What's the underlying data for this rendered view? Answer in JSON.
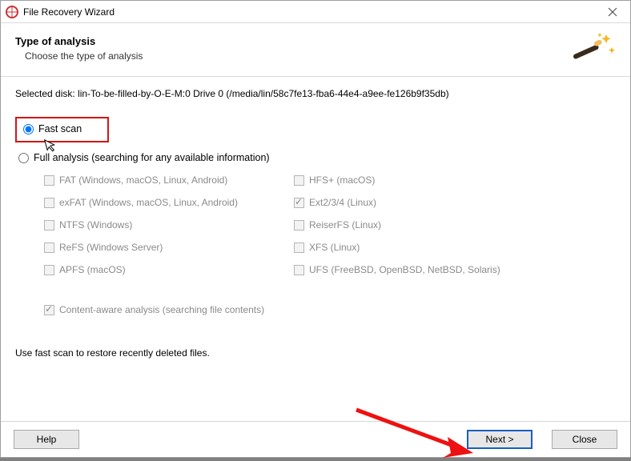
{
  "titlebar": {
    "title": "File Recovery Wizard"
  },
  "header": {
    "title": "Type of analysis",
    "subtitle": "Choose the type of analysis"
  },
  "body": {
    "selected_disk": "Selected disk: lin-To-be-filled-by-O-E-M:0 Drive 0 (/media/lin/58c7fe13-fba6-44e4-a9ee-fe126b9f35db)",
    "radio_fast": "Fast scan",
    "radio_full": "Full analysis (searching for any available information)",
    "fs_left": [
      "FAT (Windows, macOS, Linux, Android)",
      "exFAT (Windows, macOS, Linux, Android)",
      "NTFS (Windows)",
      "ReFS (Windows Server)",
      "APFS (macOS)"
    ],
    "fs_right": [
      "HFS+ (macOS)",
      "Ext2/3/4 (Linux)",
      "ReiserFS (Linux)",
      "XFS (Linux)",
      "UFS (FreeBSD, OpenBSD, NetBSD, Solaris)"
    ],
    "fs_right_checked_index": 1,
    "content_aware": "Content-aware analysis (searching file contents)",
    "tip": "Use fast scan to restore recently deleted files."
  },
  "footer": {
    "help": "Help",
    "next": "Next >",
    "close": "Close"
  }
}
